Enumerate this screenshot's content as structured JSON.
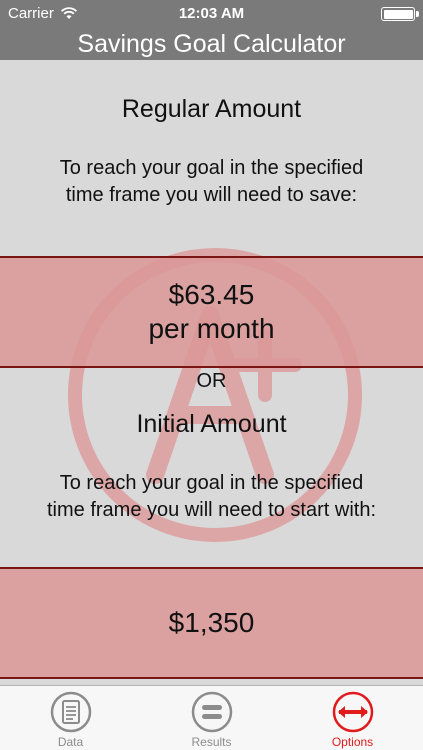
{
  "status_bar": {
    "carrier": "Carrier",
    "time": "12:03 AM"
  },
  "nav": {
    "title": "Savings Goal Calculator"
  },
  "regular": {
    "heading": "Regular Amount",
    "desc_line1": "To reach your goal in the specified",
    "desc_line2": "time frame you will need to save:",
    "amount": "$63.45",
    "period": "per month"
  },
  "or_label": "OR",
  "initial": {
    "heading": "Initial Amount",
    "desc_line1": "To reach your goal in the specified",
    "desc_line2": "time frame you will need to start with:",
    "amount": "$1,350"
  },
  "tabs": [
    {
      "label": "Data",
      "icon": "notepad-icon",
      "active": false
    },
    {
      "label": "Results",
      "icon": "equals-icon",
      "active": false
    },
    {
      "label": "Options",
      "icon": "arrows-icon",
      "active": true
    }
  ],
  "colors": {
    "bar": "#7a7a7a",
    "band": "#da9696",
    "band_border": "#7b1515",
    "active": "#e11b1b",
    "inactive": "#8c8c8c"
  }
}
